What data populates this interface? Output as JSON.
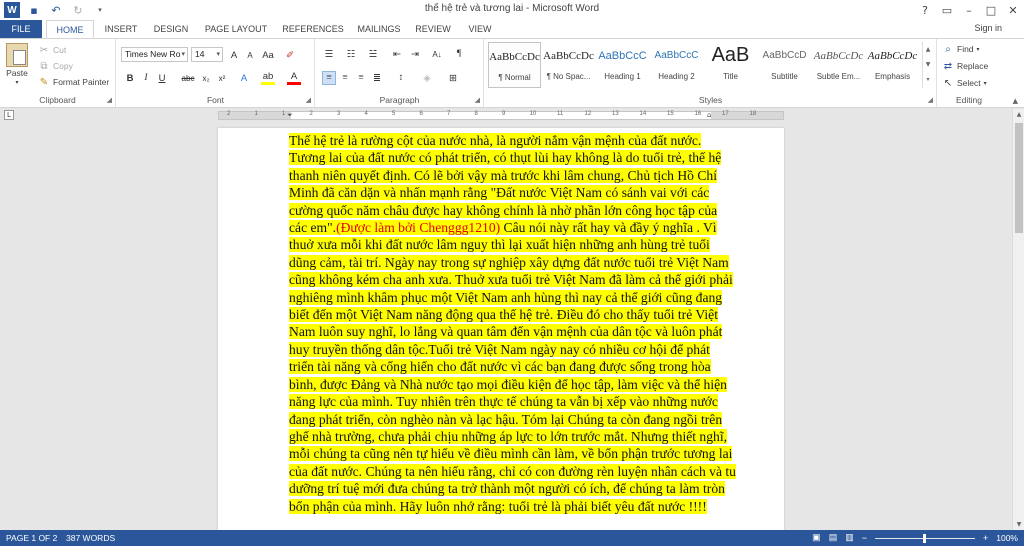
{
  "window": {
    "title": "thế hệ trẻ và tương lai - Microsoft Word",
    "controls": [
      "?",
      "restore",
      "minimize",
      "maximize",
      "close"
    ]
  },
  "qat": {
    "undo_icon": "undo-icon",
    "redo_icon": "redo-icon",
    "save_icon": "save-icon"
  },
  "tabs": [
    "FILE",
    "HOME",
    "INSERT",
    "DESIGN",
    "PAGE LAYOUT",
    "REFERENCES",
    "MAILINGS",
    "REVIEW",
    "VIEW"
  ],
  "signin": "Sign in",
  "clipboard": {
    "paste": "Paste",
    "cut": "Cut",
    "copy": "Copy",
    "format_painter": "Format Painter",
    "label": "Clipboard"
  },
  "font": {
    "name": "Times New Ro",
    "size": "14",
    "label": "Font",
    "bold": "B",
    "italic": "I",
    "underline": "U",
    "strike": "abc",
    "subscript": "x₂",
    "superscript": "x²",
    "grow": "A",
    "shrink": "A",
    "case": "Aa",
    "highlight_color": "#ffff00",
    "font_color": "#ff0000"
  },
  "paragraph": {
    "label": "Paragraph"
  },
  "styles": {
    "label": "Styles",
    "items": [
      {
        "sample": "AaBbCcDc",
        "name": "¶ Normal"
      },
      {
        "sample": "AaBbCcDc",
        "name": "¶ No Spac..."
      },
      {
        "sample": "AaBbCcC",
        "name": "Heading 1"
      },
      {
        "sample": "AaBbCcC",
        "name": "Heading 2"
      },
      {
        "sample": "AaB",
        "name": "Title"
      },
      {
        "sample": "AaBbCcD",
        "name": "Subtitle"
      },
      {
        "sample": "AaBbCcDc",
        "name": "Subtle Em..."
      },
      {
        "sample": "AaBbCcDc",
        "name": "Emphasis"
      }
    ]
  },
  "editing": {
    "label": "Editing",
    "find": "Find",
    "replace": "Replace",
    "select": "Select"
  },
  "ruler": {
    "ticks": [
      "2",
      "1",
      "1",
      "2",
      "3",
      "4",
      "5",
      "6",
      "7",
      "8",
      "9",
      "10",
      "11",
      "12",
      "13",
      "14",
      "15",
      "16",
      "17",
      "18"
    ]
  },
  "document": {
    "text_before": "Thế hệ trẻ là rường cột của nước nhà, là người nắm vận mệnh của đất nước. Tương lai của đất nước có phát triển, có thụt lùi hay không là do tuổi trẻ, thế hệ thanh niên quyết định. Có lẽ bởi vậy mà trước khi lâm chung, Chủ tịch Hồ Chí Minh đã căn dặn và nhấn mạnh rằng \"Đất nước Việt Nam có sánh vai với các cường quốc năm châu được hay không chính là nhờ phần lớn công học tập của các em\".",
    "text_red": "(Được làm bởi Chenggg1210)",
    "text_after": " Câu nói này rất hay và đầy ý nghĩa . Vì thuở xưa mỗi khi đất nước lâm nguy thì lại xuất hiện những anh hùng trẻ tuổi dũng cảm, tài trí. Ngày nay trong sự nghiệp xây dựng đất nước tuổi trẻ Việt Nam cũng không kém cha anh xưa. Thuở xưa tuổi trẻ Việt Nam đã làm cả thế giới phải nghiêng mình khâm phục một Việt Nam anh hùng thì nay cả thế giới cũng đang biết đến một Việt Nam năng động qua thế hệ trẻ. Điều đó cho thấy tuổi trẻ Việt Nam luôn suy nghĩ, lo lắng và quan tâm đến vận mệnh của dân tộc và luôn phát huy truyền thống dân tộc.Tuổi trẻ Việt Nam ngày nay có nhiều cơ hội để phát triển tài năng và cống hiến cho đất nước vì các bạn đang được sống trong hòa bình, được Đảng và Nhà nước tạo mọi điều kiện để học tập, làm việc và thể hiện năng lực của mình.  Tuy nhiên trên thực tế chúng ta vẫn bị xếp vào những nước đang phát triển, còn nghèo nàn và lạc hậu.  Tóm lại Chúng ta còn đang ngồi trên ghế nhà trường, chưa phải chịu những áp lực to lớn trước mắt. Nhưng thiết nghĩ, mỗi chúng ta cũng nên tự hiểu về điều mình cần làm, về bổn phận trước tương lai của đất nước. Chúng ta nên hiểu rằng, chỉ có con đường rèn luyện nhân cách và tu dưỡng trí tuệ mới đưa chúng ta trở thành một người có ích, để chúng ta làm tròn bổn phận của mình. Hãy luôn nhớ rằng: tuổi trẻ là phải biết yêu đất nước !!!!",
    "highlight_color": "#ffff00",
    "red_color": "#e60000"
  },
  "status": {
    "page": "PAGE 1 OF 2",
    "words": "387 WORDS",
    "zoom": "100%",
    "zoom_minus": "−",
    "zoom_plus": "+"
  }
}
